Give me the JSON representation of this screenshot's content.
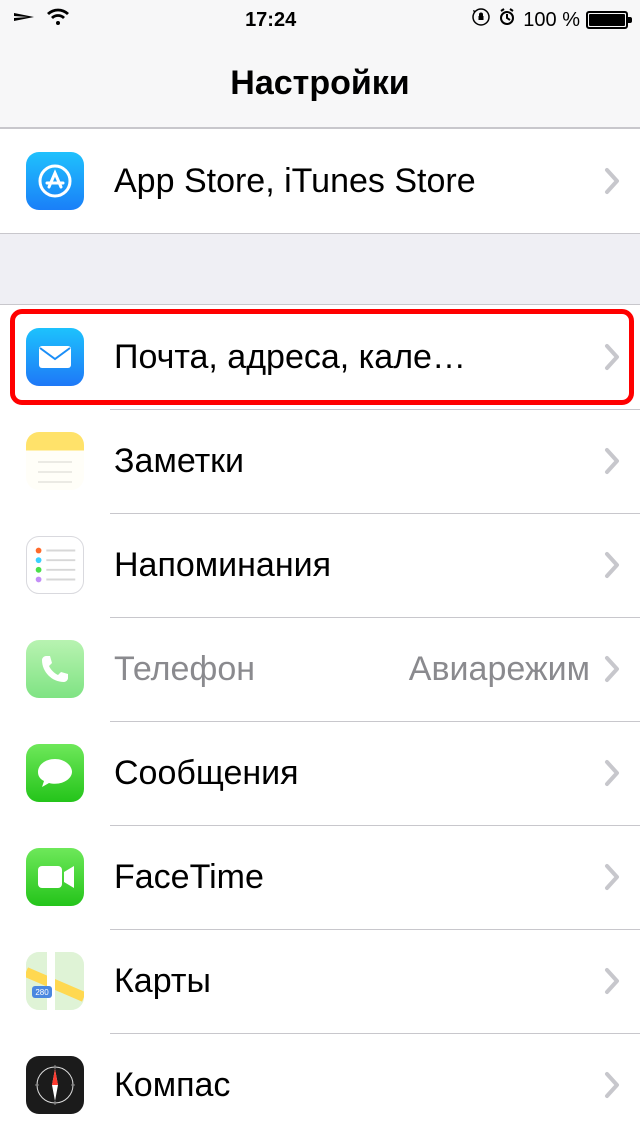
{
  "statusbar": {
    "time": "17:24",
    "battery_text": "100 %"
  },
  "header": {
    "title": "Настройки"
  },
  "group1": {
    "items": [
      {
        "label": "App Store, iTunes Store"
      }
    ]
  },
  "group2": {
    "items": [
      {
        "label": "Почта, адреса, кале…"
      },
      {
        "label": "Заметки"
      },
      {
        "label": "Напоминания"
      },
      {
        "label": "Телефон",
        "detail": "Авиарежим"
      },
      {
        "label": "Сообщения"
      },
      {
        "label": "FaceTime"
      },
      {
        "label": "Карты"
      },
      {
        "label": "Компас"
      }
    ]
  }
}
